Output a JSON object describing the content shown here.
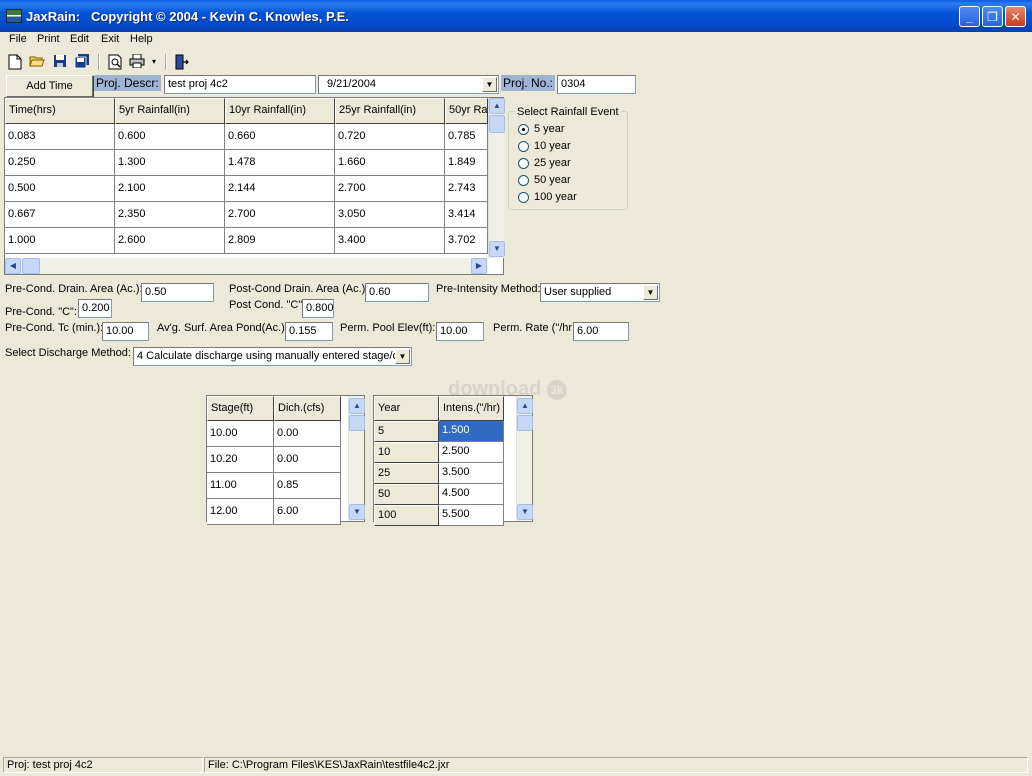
{
  "window": {
    "title": "JaxRain:   Copyright © 2004 - Kevin C. Knowles, P.E."
  },
  "menu": [
    "File",
    "Print",
    "Edit",
    "Exit",
    "Help"
  ],
  "toolbar_icons": [
    "new-file-icon",
    "open-folder-icon",
    "save-icon",
    "save-all-icon",
    "preview-icon",
    "print-icon",
    "dropdown-arrow-icon",
    "exit-door-icon"
  ],
  "top_controls": {
    "add_time_label": "Add Time",
    "proj_descr_label": "Proj. Descr:",
    "proj_descr_value": "test proj 4c2",
    "date_value": "9/21/2004",
    "proj_no_label": "Proj. No.:",
    "proj_no_value": "0304"
  },
  "rainfall_table": {
    "headers": [
      "Time(hrs)",
      "5yr Rainfall(in)",
      "10yr Rainfall(in)",
      "25yr Rainfall(in)",
      "50yr Rai"
    ],
    "rows": [
      [
        "0.083",
        "0.600",
        "0.660",
        "0.720",
        "0.785"
      ],
      [
        "0.250",
        "1.300",
        "1.478",
        "1.660",
        "1.849"
      ],
      [
        "0.500",
        "2.100",
        "2.144",
        "2.700",
        "2.743"
      ],
      [
        "0.667",
        "2.350",
        "2.700",
        "3.050",
        "3.414"
      ],
      [
        "1.000",
        "2.600",
        "2.809",
        "3.400",
        "3.702"
      ]
    ]
  },
  "rainfall_event": {
    "title": "Select Rainfall Event",
    "options": [
      "5 year",
      "10 year",
      "25 year",
      "50 year",
      "100 year"
    ],
    "selected_index": 0
  },
  "params": {
    "pre_drain_label": "Pre-Cond. Drain. Area (Ac.):",
    "pre_drain_value": "0.50",
    "post_drain_label": "Post-Cond Drain. Area (Ac.):",
    "post_drain_value": "0.60",
    "pre_intensity_label": "Pre-Intensity Method:",
    "pre_intensity_value": "User supplied",
    "pre_c_label": "Pre-Cond. \"C\":",
    "pre_c_value": "0.200",
    "post_c_label": "Post Cond. \"C\"",
    "post_c_value": "0.800",
    "pre_tc_label": "Pre-Cond. Tc (min.):",
    "pre_tc_value": "10.00",
    "avg_surf_label": "Av'g. Surf. Area Pond(Ac.):",
    "avg_surf_value": "0.155",
    "perm_pool_label": "Perm. Pool Elev(ft):",
    "perm_pool_value": "10.00",
    "perm_rate_label": "Perm. Rate (\"/hr",
    "perm_rate_value": "6.00",
    "discharge_label": "Select Discharge Method:",
    "discharge_value": "4  Calculate discharge using manually entered stage/d"
  },
  "stage_table": {
    "headers": [
      "Stage(ft)",
      "Dich.(cfs)"
    ],
    "rows": [
      [
        "10.00",
        "0.00"
      ],
      [
        "10.20",
        "0.00"
      ],
      [
        "11.00",
        "0.85"
      ],
      [
        "12.00",
        "6.00"
      ]
    ]
  },
  "intensity_table": {
    "headers": [
      "Year",
      "Intens.(\"/hr)"
    ],
    "rows": [
      [
        " 5",
        "1.500"
      ],
      [
        "10",
        "2.500"
      ],
      [
        "25",
        "3.500"
      ],
      [
        "50",
        "4.500"
      ],
      [
        "100",
        "5.500"
      ]
    ],
    "selected_row": 0
  },
  "watermark": "download",
  "status": {
    "project": "Proj: test proj 4c2",
    "file": "File: C:\\Program Files\\KES\\JaxRain\\testfile4c2.jxr"
  }
}
